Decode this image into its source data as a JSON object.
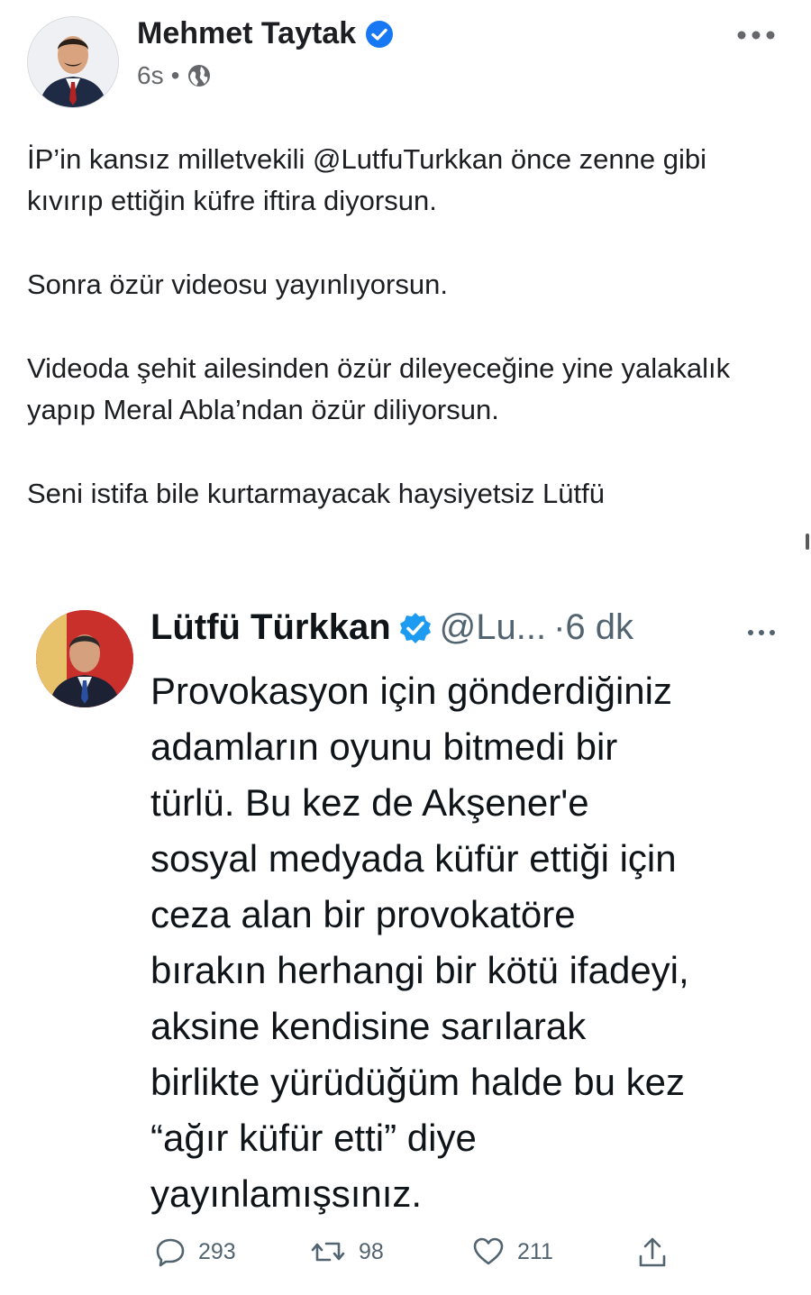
{
  "post": {
    "author": "Mehmet Taytak",
    "time": "6s",
    "separator": "•",
    "paragraphs": [
      "İP’in kansız milletvekili @LutfuTurkkan önce zenne gibi kıvırıp ettiğin küfre iftira diyorsun.",
      "Sonra özür videosu yayınlıyorsun.",
      "Videoda şehit ailesinden özür dileyeceğine yine yalakalık yapıp Meral Abla’ndan özür diliyorsun.",
      "Seni istifa bile kurtarmayacak haysiyetsiz Lütfü"
    ],
    "icons": {
      "verified": "verified-badge-icon",
      "privacy": "globe-icon",
      "menu": "more-dots-icon"
    },
    "colors": {
      "verified": "#1877f2",
      "meta": "#65676b"
    }
  },
  "tweet": {
    "name": "Lütfü Türkkan",
    "handle": "@Lu...",
    "time": "·6 dk",
    "text": "Provokasyon için gönderdiğiniz\nadamların oyunu bitmedi bir\ntürlü.  Bu kez de Akşener'e\nsosyal medyada küfür ettiği için\nceza alan bir provokatöre\nbırakın herhangi bir kötü ifadeyi,\naksine kendisine sarılarak\nbirlikte yürüdüğüm halde bu kez\n“ağır küfür etti” diye\nyayınlamışsınız.",
    "actions": {
      "replies": "293",
      "retweets": "98",
      "likes": "211"
    },
    "icons": {
      "verified": "verified-badge-icon",
      "reply": "reply-icon",
      "retweet": "retweet-icon",
      "like": "heart-icon",
      "share": "share-icon",
      "menu": "more-dots-icon"
    },
    "colors": {
      "verified": "#1d9bf0",
      "muted": "#536471"
    }
  }
}
